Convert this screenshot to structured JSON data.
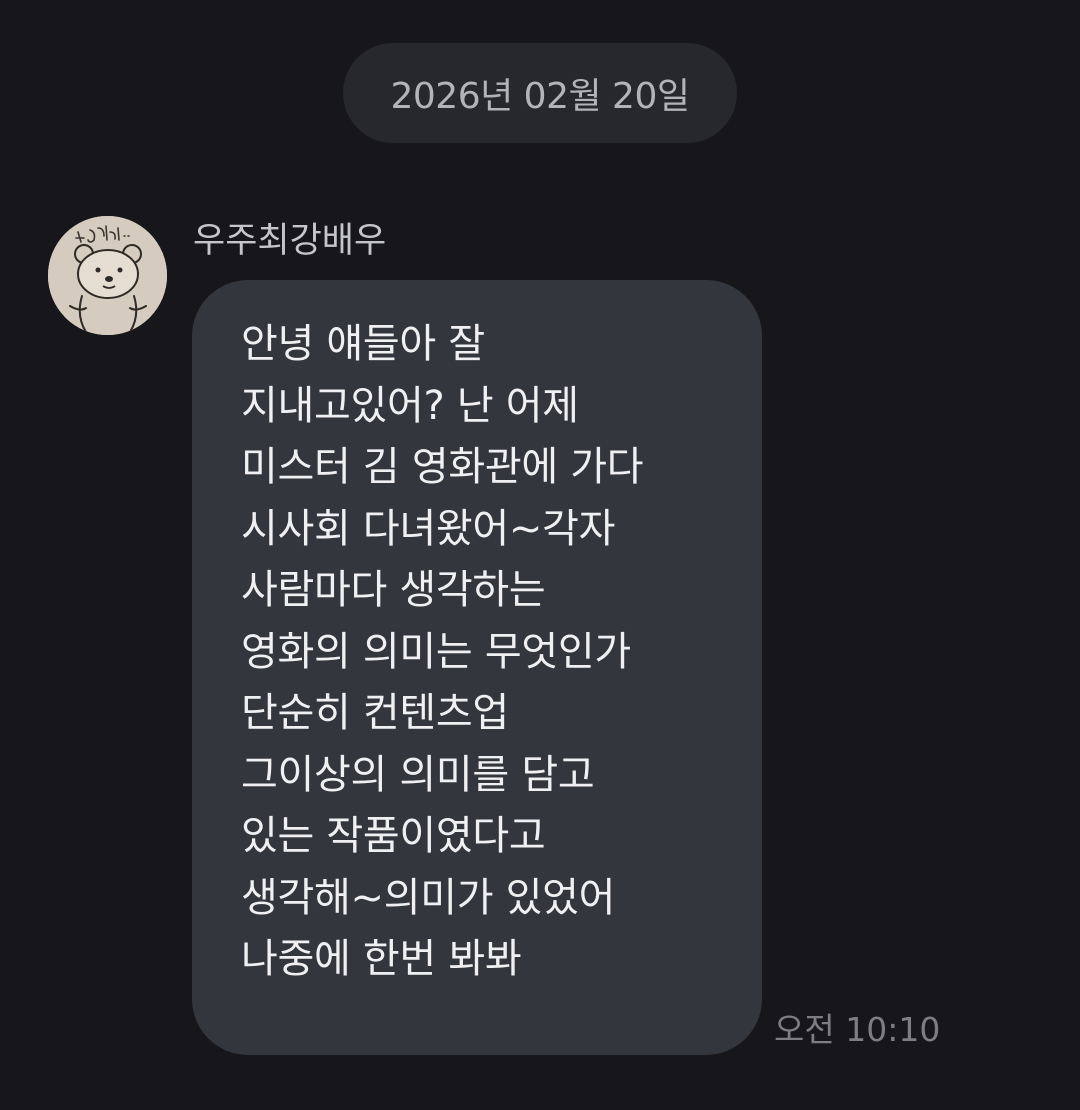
{
  "date_divider": "2026년 02월 20일",
  "message": {
    "sender": "우주최강배우",
    "avatar_caption": "나 안아..",
    "lines": [
      "안녕 얘들아 잘",
      "지내고있어? 난 어제",
      "미스터 김 영화관에 가다",
      "시사회 다녀왔어~각자",
      "사람마다 생각하는",
      "영화의 의미는 무엇인가",
      "단순히 컨텐츠업",
      "그이상의 의미를 담고",
      "있는 작품이였다고",
      "생각해~의미가 있었어",
      "나중에 한번 봐봐"
    ],
    "time": "오전 10:10"
  },
  "colors": {
    "background": "#17171b",
    "date_pill": "#27282c",
    "bubble": "#34363d",
    "message_text": "#f0f0f2",
    "time_text": "#7d7e84"
  },
  "icons": {
    "avatar": "hand-drawn-bear-avatar"
  }
}
